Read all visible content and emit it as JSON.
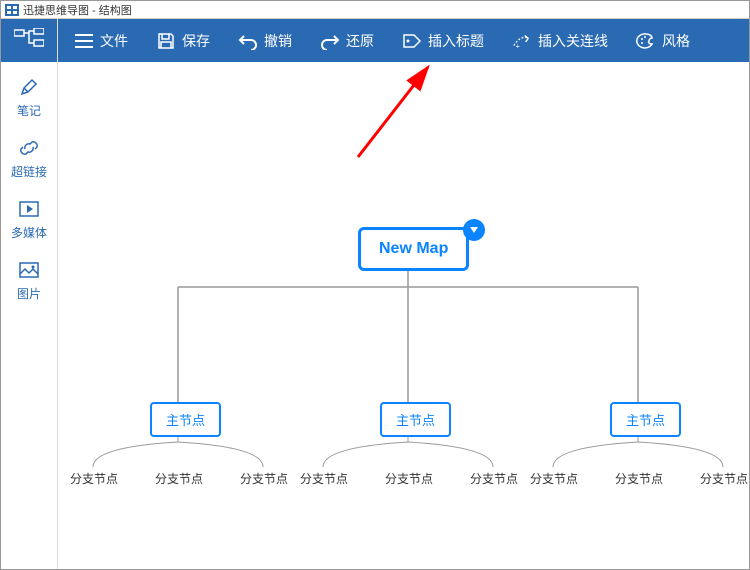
{
  "window": {
    "title": "迅捷思维导图 - 结构图"
  },
  "toolbar": {
    "file": "文件",
    "save": "保存",
    "undo": "撤销",
    "redo": "还原",
    "insert_title": "插入标题",
    "insert_connector": "插入关连线",
    "style": "风格"
  },
  "sidebar": {
    "note": "笔记",
    "hyperlink": "超链接",
    "multimedia": "多媒体",
    "image": "图片"
  },
  "map": {
    "root": "New Map",
    "main": [
      "主节点",
      "主节点",
      "主节点"
    ],
    "leaf": "分支节点"
  },
  "colors": {
    "brand": "#2a6ab3",
    "accent": "#0a84ff",
    "arrow": "#ff0000"
  }
}
